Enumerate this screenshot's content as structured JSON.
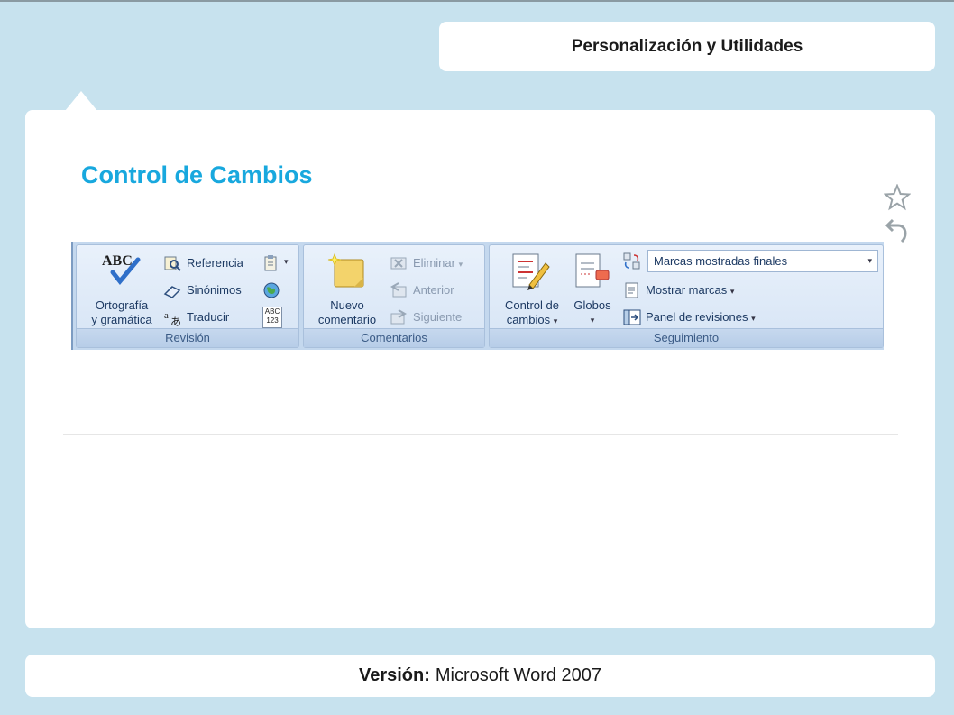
{
  "header": {
    "title": "Personalización y Utilidades"
  },
  "card": {
    "title": "Control de Cambios"
  },
  "ribbon": {
    "revision": {
      "label": "Revisión",
      "spelling_line1": "Ortografía",
      "spelling_line2": "y gramática",
      "abc_glyph": "ABC",
      "reference": "Referencia",
      "synonyms": "Sinónimos",
      "translate": "Traducir",
      "word_count_line1": "ABC",
      "word_count_line2": "123"
    },
    "comentarios": {
      "label": "Comentarios",
      "new_line1": "Nuevo",
      "new_line2": "comentario",
      "delete": "Eliminar",
      "previous": "Anterior",
      "next": "Siguiente"
    },
    "seguimiento": {
      "label": "Seguimiento",
      "track_line1": "Control de",
      "track_line2": "cambios",
      "balloons": "Globos",
      "markup_select": "Marcas mostradas finales",
      "show_markup": "Mostrar marcas",
      "review_pane": "Panel de revisiones"
    },
    "caret": "▾"
  },
  "footer": {
    "version_label": "Versión:",
    "version_value": "Microsoft Word 2007"
  },
  "icons": {
    "star": "star-icon",
    "back": "back-arrow-icon"
  },
  "colors": {
    "accent": "#18a8de",
    "background": "#c7e2ee"
  }
}
